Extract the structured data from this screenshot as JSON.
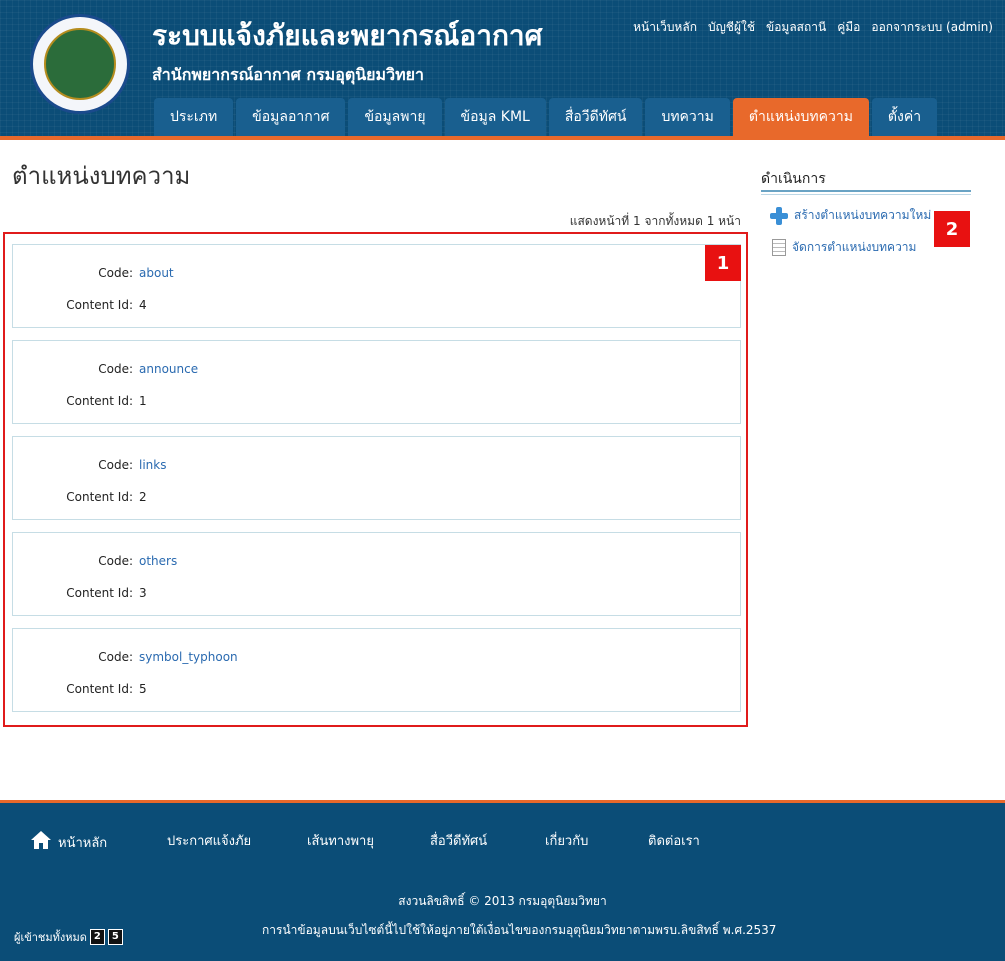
{
  "header": {
    "title": "ระบบแจ้งภัยและพยากรณ์อากาศ",
    "subtitle": "สำนักพยากรณ์อากาศ กรมอุตุนิยมวิทยา",
    "top_links": [
      "หน้าเว็บหลัก",
      "บัญชีผู้ใช้",
      "ข้อมูลสถานี",
      "คู่มือ",
      "ออกจากระบบ (admin)"
    ],
    "tabs": [
      "ประเภท",
      "ข้อมูลอากาศ",
      "ข้อมูลพายุ",
      "ข้อมูล KML",
      "สื่อวีดีทัศน์",
      "บทความ",
      "ตำแหน่งบทความ",
      "ตั้งค่า"
    ],
    "active_tab": "ตำแหน่งบทความ"
  },
  "main": {
    "page_title": "ตำแหน่งบทความ",
    "pager_text": "แสดงหน้าที่ 1 จากทั้งหมด 1 หน้า",
    "code_label": "Code:",
    "content_id_label": "Content Id:",
    "records": [
      {
        "code": "about",
        "content_id": "4"
      },
      {
        "code": "announce",
        "content_id": "1"
      },
      {
        "code": "links",
        "content_id": "2"
      },
      {
        "code": "others",
        "content_id": "3"
      },
      {
        "code": "symbol_typhoon",
        "content_id": "5"
      }
    ]
  },
  "annotations": {
    "badge1": "1",
    "badge2": "2"
  },
  "sidebar": {
    "title": "ดำเนินการ",
    "items": [
      {
        "label": "สร้างตำแหน่งบทความใหม่",
        "icon": "plus-icon"
      },
      {
        "label": "จัดการตำแหน่งบทความ",
        "icon": "document-list-icon"
      }
    ]
  },
  "footer": {
    "nav": [
      "หน้าหลัก",
      "ประกาศแจ้งภัย",
      "เส้นทางพายุ",
      "สื่อวีดีทัศน์",
      "เกี่ยวกับ",
      "ติดต่อเรา"
    ],
    "copyright": "สงวนลิขสิทธิ์ © 2013 กรมอุตุนิยมวิทยา",
    "notice": "การนำข้อมูลบนเว็บไซต์นี้ไปใช้ให้อยู่ภายใต้เงื่อนไขของกรมอุตุนิยมวิทยาตามพรบ.ลิขสิทธิ์ พ.ศ.2537",
    "visitors_label": "ผู้เข้าชมทั้งหมด",
    "visitor_digits": [
      "2",
      "5"
    ]
  },
  "colors": {
    "header_bg": "#0b4d77",
    "accent": "#e8692b",
    "link": "#2a6ab0",
    "highlight_box": "#e01b1b"
  }
}
